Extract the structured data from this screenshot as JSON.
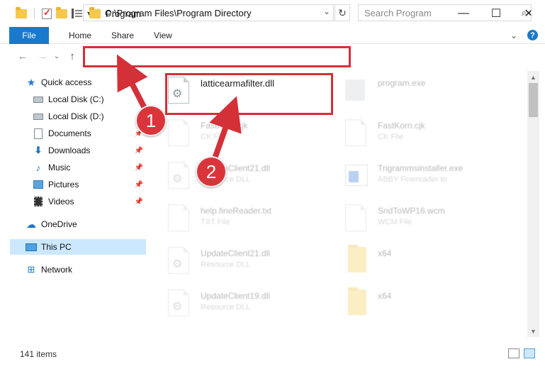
{
  "window": {
    "title": "Program",
    "minimize": "—",
    "maximize": "☐",
    "close": "✕"
  },
  "ribbon": {
    "file": "File",
    "tabs": [
      "Home",
      "Share",
      "View"
    ],
    "collapse": "⌄",
    "help": "?"
  },
  "nav": {
    "back": "←",
    "forward": "→",
    "recent": "⌄",
    "up": "↑",
    "address": "C:\\Program Files\\Program Directory",
    "address_dropdown": "⌄",
    "refresh": "↻",
    "search_placeholder": "Search Program",
    "search_icon": "⌕"
  },
  "sidebar": {
    "items": [
      {
        "label": "Quick access",
        "icon": "star-icon"
      },
      {
        "label": "Local Disk (C:)",
        "icon": "drive-icon"
      },
      {
        "label": "Local Disk (D:)",
        "icon": "drive-icon"
      },
      {
        "label": "Documents",
        "icon": "documents-icon",
        "pinned": true
      },
      {
        "label": "Downloads",
        "icon": "download-icon",
        "pinned": true
      },
      {
        "label": "Music",
        "icon": "music-icon",
        "pinned": true
      },
      {
        "label": "Pictures",
        "icon": "pictures-icon",
        "pinned": true
      },
      {
        "label": "Videos",
        "icon": "videos-icon",
        "pinned": true
      },
      {
        "label": "OneDrive",
        "icon": "cloud-icon"
      },
      {
        "label": "This PC",
        "icon": "pc-icon",
        "selected": true
      },
      {
        "label": "Network",
        "icon": "network-icon"
      }
    ]
  },
  "files": [
    {
      "name": "latticearmafilter.dll",
      "type": "",
      "icon": "dll-icon",
      "highlight": true
    },
    {
      "name": "program.exe",
      "type": "",
      "icon": "exe-icon"
    },
    {
      "name": "FastKorn.cjk",
      "type": "CK File",
      "icon": "file-icon"
    },
    {
      "name": "FastKorn.cjk",
      "type": "CK File",
      "icon": "file-icon"
    },
    {
      "name": "UpdateClient21.dll",
      "type": "Resource DLL",
      "icon": "dll-icon"
    },
    {
      "name": "Trigrammsinstaller.exe",
      "type": "ABBY Finereader to",
      "icon": "installer-icon"
    },
    {
      "name": "help.fineReader.txt",
      "type": "TXT File",
      "icon": "file-icon"
    },
    {
      "name": "SndToWP16.wcm",
      "type": "WCM File",
      "icon": "file-icon"
    },
    {
      "name": "UpdateClient21.dll",
      "type": "Resource DLL",
      "icon": "dll-icon"
    },
    {
      "name": "x64",
      "type": "",
      "icon": "folder-icon"
    },
    {
      "name": "UpdateClient19.dll",
      "type": "Resource DLL",
      "icon": "dll-icon"
    },
    {
      "name": "x64",
      "type": "",
      "icon": "folder-icon"
    }
  ],
  "status": {
    "count": "141 items"
  },
  "annotations": {
    "step1": "1",
    "step2": "2",
    "color": "#d33038"
  }
}
